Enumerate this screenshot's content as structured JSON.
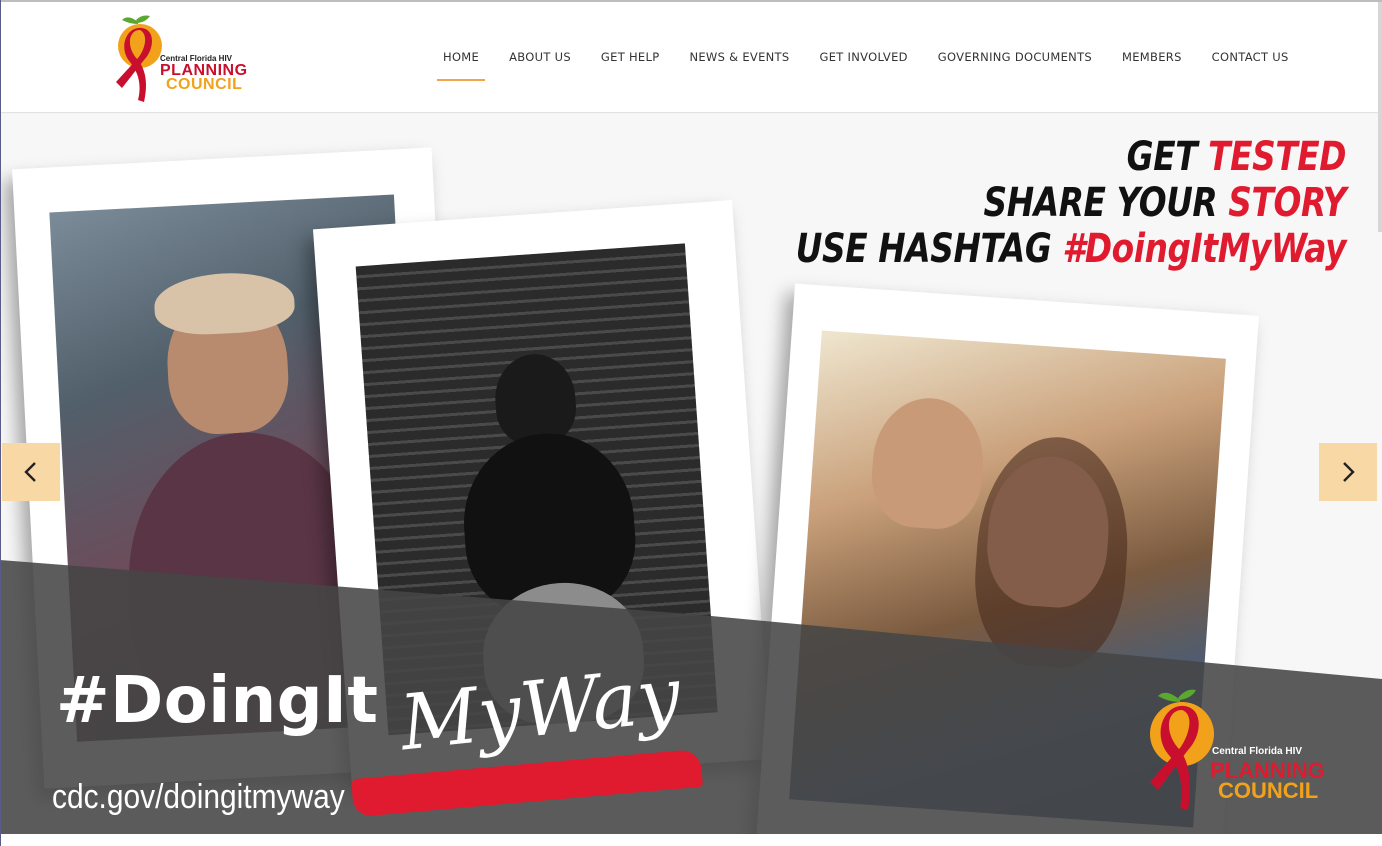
{
  "header": {
    "logo": {
      "small_text": "Central Florida HIV",
      "planning": "PLANNING",
      "council": "COUNCIL"
    },
    "nav": [
      {
        "label": "HOME",
        "active": true
      },
      {
        "label": "ABOUT US"
      },
      {
        "label": "GET HELP"
      },
      {
        "label": "NEWS & EVENTS"
      },
      {
        "label": "GET INVOLVED"
      },
      {
        "label": "GOVERNING DOCUMENTS"
      },
      {
        "label": "MEMBERS"
      },
      {
        "label": "CONTACT US"
      }
    ]
  },
  "hero": {
    "line1_a": "GET ",
    "line1_b": "TESTED",
    "line2_a": "SHARE YOUR ",
    "line2_b": "STORY",
    "line3_a": "USE HASHTAG ",
    "line3_b": "#DoingItMyWay",
    "hashtag": "#DoingIt",
    "script": "MyWay",
    "url": "cdc.gov/doingitmyway",
    "logo_small": "Central Florida HIV",
    "logo_planning": "PLANNING",
    "logo_council": "COUNCIL"
  },
  "slider": {
    "prev_icon": "chevron-left-icon",
    "next_icon": "chevron-right-icon"
  },
  "colors": {
    "accent": "#f0a54a",
    "red": "#e01b2f",
    "orange": "#f2a21a"
  }
}
